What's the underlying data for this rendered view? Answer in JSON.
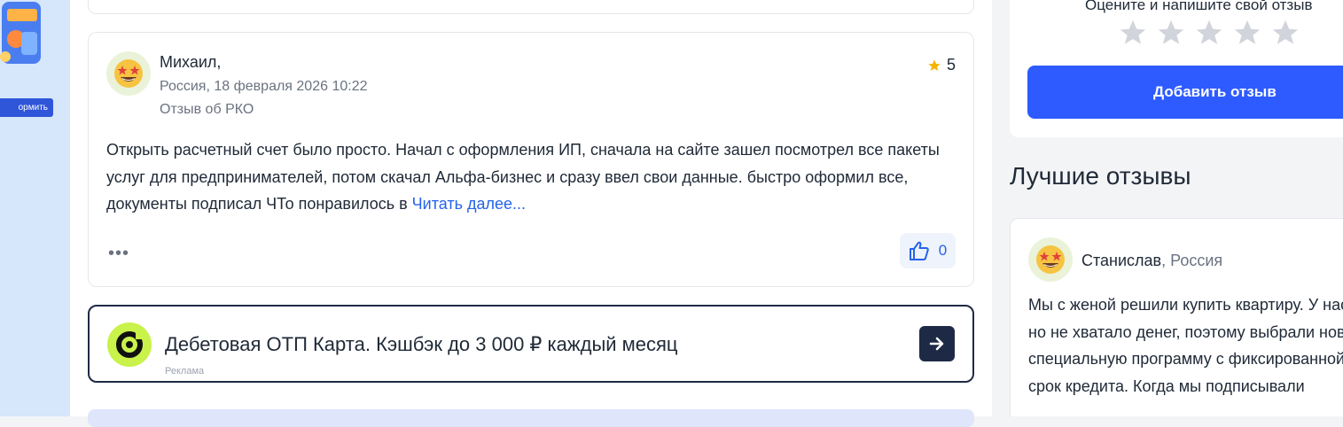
{
  "left_banner": {
    "button_label": "ормить"
  },
  "review": {
    "author": "Михаил,",
    "location_date": "Россия, 18 февраля 2026 10:22",
    "topic": "Отзыв об РКО",
    "rating": "5",
    "text": "Открыть расчетный счет было просто. Начал с оформления ИП, сначала на сайте зашел посмотрел все пакеты услуг для предпринимателей, потом скачал Альфа-бизнес и сразу ввел свои данные. быстро оформил все, документы подписал ЧТо понравилось в ",
    "read_more": "Читать далее...",
    "more_dots": "•••",
    "likes": "0"
  },
  "ad": {
    "title": "Дебетовая ОТП Карта. Кэшбэк до 3 000 ₽ каждый месяц",
    "label": "Реклама"
  },
  "sidebar": {
    "rate_prompt": "Оцените и напишите свой отзыв",
    "add_review_button": "Добавить отзыв",
    "best_reviews_title": "Лучшие отзывы",
    "best_review": {
      "author": "Станислав",
      "separator": ", ",
      "location": "Россия",
      "text": "Мы с женой решили купить квартиру. У нас были накопления, но не хватало денег, поэтому выбрали новостройку и специальную программу с фиксированной ставкой на весь срок кредита. Когда мы подписывали"
    }
  },
  "colors": {
    "accent": "#2d5bff",
    "link": "#2563eb",
    "star": "#f5b400",
    "star_empty": "#d1d5db",
    "ad_border": "#1e2a45"
  },
  "icons": {
    "rating": "star-icon",
    "like": "thumbs-up-icon",
    "ad_arrow": "arrow-right-icon",
    "avatar": "smiling-face-with-star-eyes-icon"
  }
}
